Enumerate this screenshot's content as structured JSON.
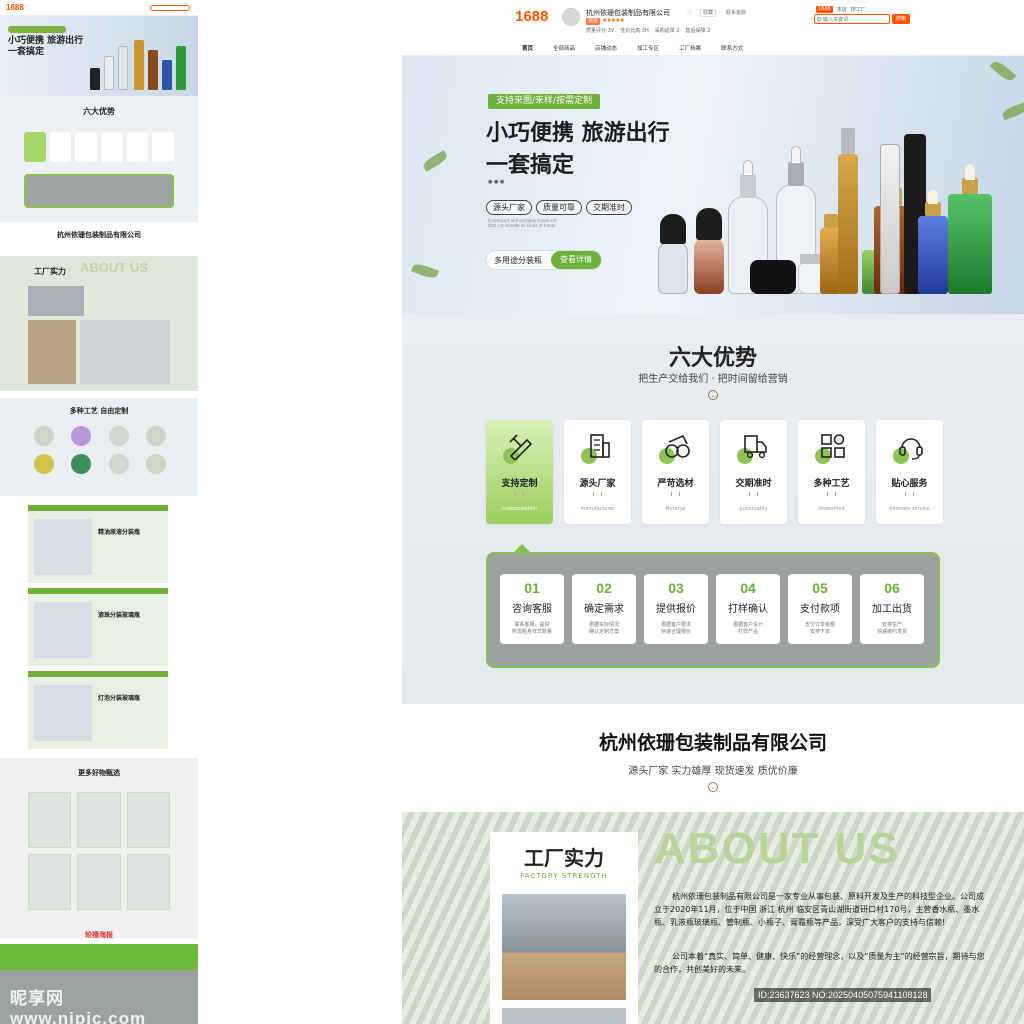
{
  "header": {
    "logo": "1688",
    "shop_name": "杭州依珊包装制品有限公司",
    "badge": "诚信",
    "stars": "★★★★★",
    "stats": [
      "质量评分 3V",
      "性价比高 3H",
      "采购返单 2",
      "售后保障 2"
    ],
    "follow": "♡",
    "fav_label": "收藏",
    "msg_label": "联系客服",
    "top_tabs": [
      "1688",
      "本店",
      "搜工厂"
    ],
    "search_placeholder": "输入关键词",
    "search_button": "搜索",
    "nav": [
      "首页",
      "全部商品",
      "店铺动态",
      "加工专区",
      "工厂档案",
      "联系方式"
    ]
  },
  "hero": {
    "tag": "支持来图/来样/按需定制",
    "title_line1": "小巧便携 旅游出行",
    "title_line2": "一套搞定",
    "dots": "● ● ●",
    "pills": [
      "源头厂家",
      "质量可靠",
      "交期准时"
    ],
    "small_text": "A compact and portable travel set that can handle all kinds of travel",
    "cta_left": "多用途分装瓶",
    "cta_right": "查看详情"
  },
  "advantages": {
    "title": "六大优势",
    "subtitle": "把生产交给我们 · 把时间留给营销",
    "cards": [
      {
        "title": "支持定制",
        "en": "customization",
        "icon": "pencil-ruler-icon"
      },
      {
        "title": "源头厂家",
        "en": "manufacturer",
        "icon": "building-icon"
      },
      {
        "title": "严苛选材",
        "en": "Material",
        "icon": "rolls-icon"
      },
      {
        "title": "交期准时",
        "en": "punctuality",
        "icon": "truck-icon"
      },
      {
        "title": "多种工艺",
        "en": "diversified",
        "icon": "grid-icon"
      },
      {
        "title": "贴心服务",
        "en": "Intimate service",
        "icon": "headset-icon"
      }
    ],
    "steps": [
      {
        "num": "01",
        "name": "咨询客服",
        "desc1": "联系客服，提供",
        "desc2": "所需瓶身样式数量"
      },
      {
        "num": "02",
        "name": "确定需求",
        "desc1": "根据实际情况",
        "desc2": "确认定制方案"
      },
      {
        "num": "03",
        "name": "提供报价",
        "desc1": "根据客户要求",
        "desc2": "快速合理报价"
      },
      {
        "num": "04",
        "name": "打样确认",
        "desc1": "根据客户设计",
        "desc2": "打样产品"
      },
      {
        "num": "05",
        "name": "支付款项",
        "desc1": "支付订单金额",
        "desc2": "安排下单"
      },
      {
        "num": "06",
        "name": "加工出货",
        "desc1": "安排生产",
        "desc2": "快速按约发货"
      }
    ]
  },
  "company": {
    "name": "杭州依珊包装制品有限公司",
    "slogan": "源头厂家 实力雄厚 现货速发 质优价廉"
  },
  "factory": {
    "title": "工厂实力",
    "subtitle": "FACTORY STRENGTH",
    "about": "ABOUT US",
    "para1": "杭州依珊包装制品有限公司是一家专业从事包装、原料开发及生产的科技型企业。公司成立于2020年11月，位于中国 浙江 杭州 临安区青山湖街道研口村170号，主营香水瓶、墨水瓶、乳液瓶玻璃瓶、管制瓶、小瓶子、膏霜瓶等产品，深受广大客户的支持与信赖!",
    "para2": "公司本着“真实、简单、健康、快乐”的经营理念，以及“质量为主”的经营宗旨，期待与您的合作，共创美好的未来。",
    "image_id": "ID:23637623 NO:20250405075941108128"
  },
  "thumbnail": {
    "six_title": "六大优势",
    "company": "杭州依珊包装制品有限公司",
    "factory": "工厂实力",
    "about": "ABOUT US",
    "craft": "多种工艺 自由定制",
    "prod1": "精油原液分装瓶",
    "prod2": "滚珠分装玻璃瓶",
    "prod3": "灯泡分装玻璃瓶",
    "more": "更多好物甄选",
    "poster": "轮播海报",
    "watermark": "昵享网 www.nipic.com"
  },
  "colors": {
    "brand_orange": "#ff5500",
    "accent_green": "#6fb03b",
    "step_panel": "#9ca19e"
  }
}
